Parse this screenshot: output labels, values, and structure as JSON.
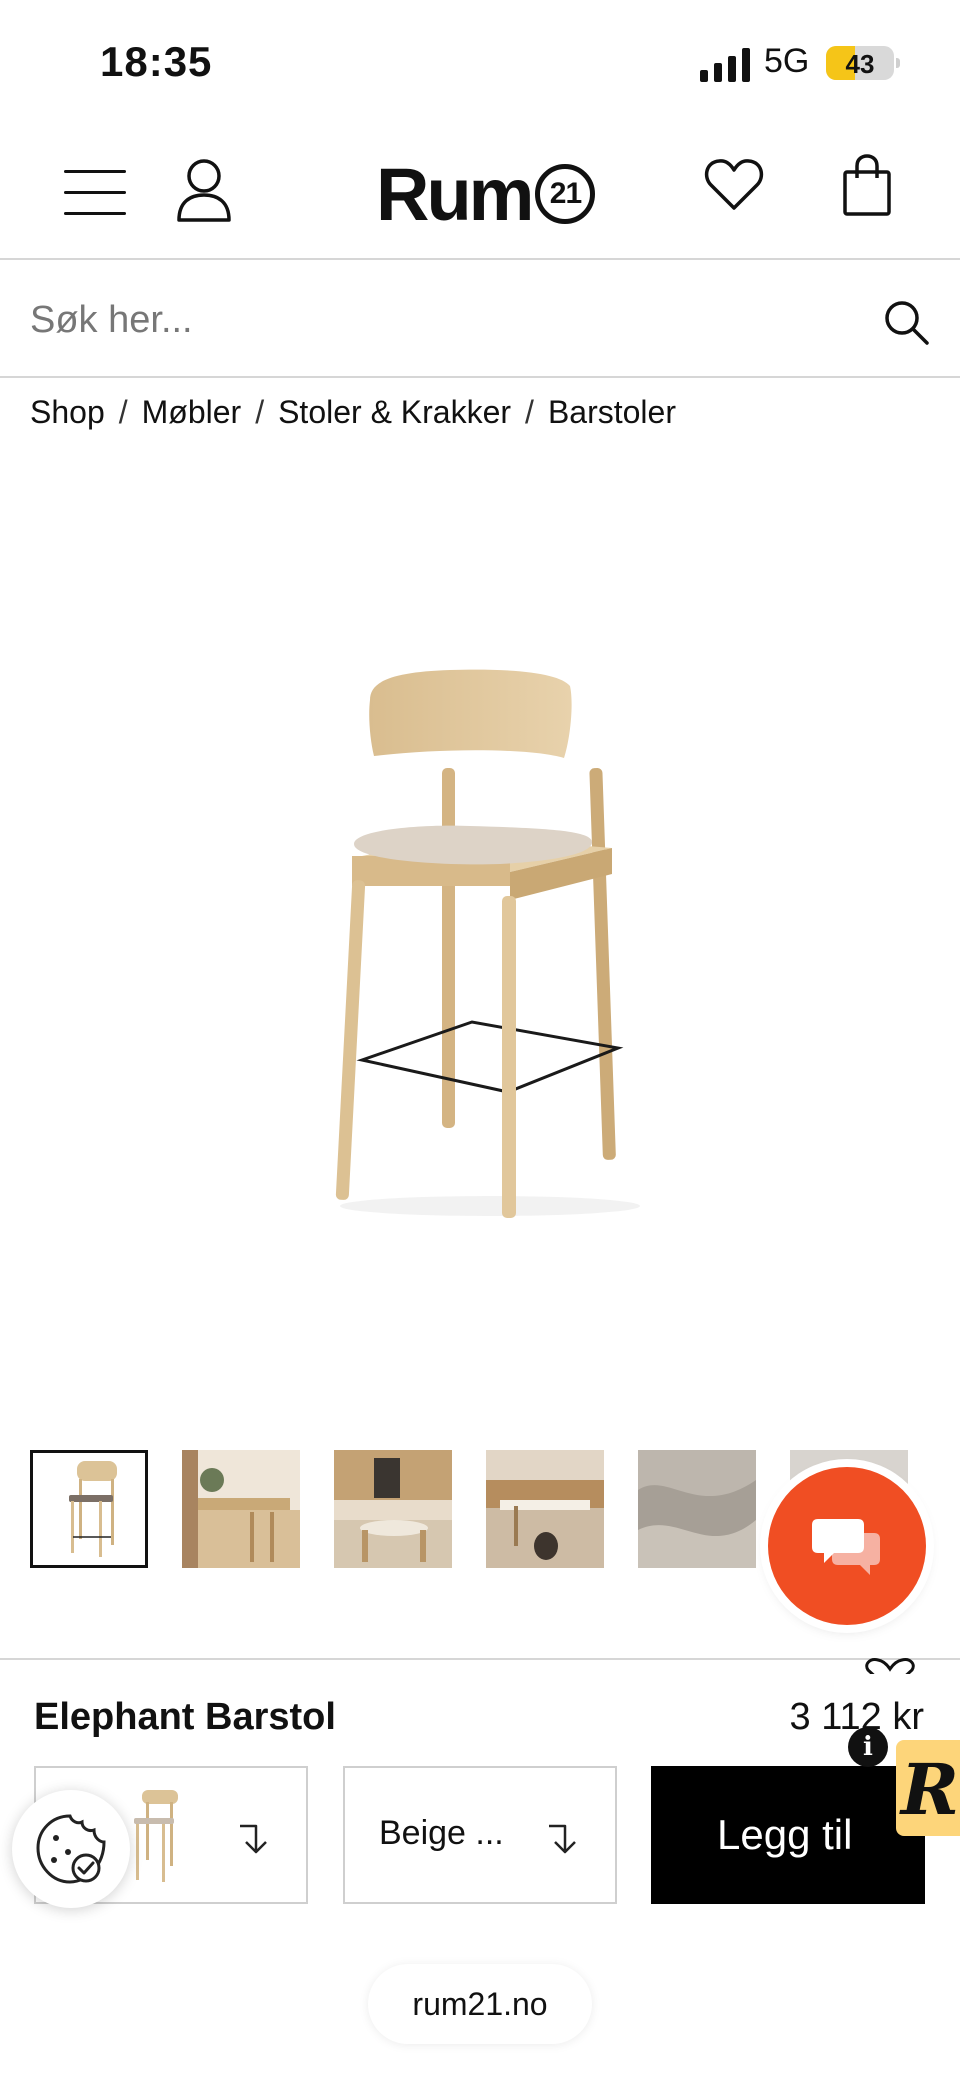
{
  "status_bar": {
    "time": "18:35",
    "network": "5G",
    "battery": "43",
    "battery_level": 0.43
  },
  "header": {
    "logo_text": "Rum",
    "logo_number": "21"
  },
  "search": {
    "placeholder": "Søk her..."
  },
  "breadcrumb": [
    "Shop",
    "Møbler",
    "Stoler & Krakker",
    "Barstoler"
  ],
  "thumbnail_icons": [
    "chair-thumb",
    "kitchen-thumb",
    "dining-thumb",
    "interior-thumb",
    "fabric-thumb",
    "partial-thumb"
  ],
  "product": {
    "name": "Elephant Barstol",
    "price": "3 112 kr",
    "color_value": "Beige ...",
    "add_label": "Legg til"
  },
  "browser": {
    "url": "rum21.no"
  },
  "colors": {
    "accent_chat": "#f04e23",
    "badge_yellow": "#fdd57a",
    "battery_yellow": "#f5c518",
    "button_black": "#000000"
  }
}
